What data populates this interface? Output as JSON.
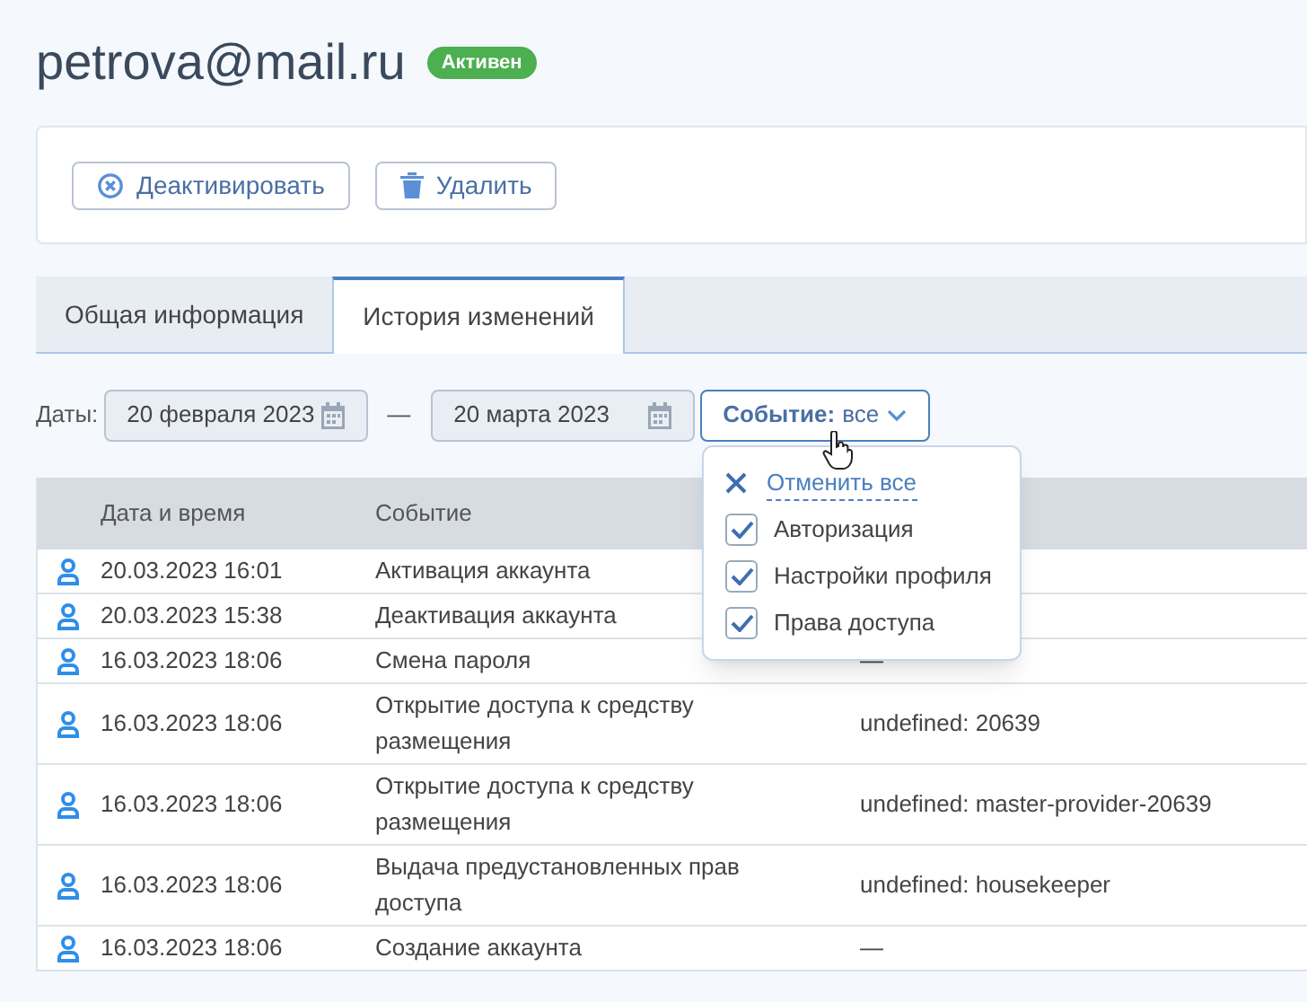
{
  "title": "petrova@mail.ru",
  "status_badge": "Активен",
  "actions": [
    {
      "kind": "deactivate",
      "label": "Деактивировать"
    },
    {
      "kind": "delete",
      "label": "Удалить"
    }
  ],
  "tabs": [
    {
      "label": "Общая информация",
      "selected": false
    },
    {
      "label": "История изменений",
      "selected": true
    }
  ],
  "filters": {
    "dates_label": "Даты:",
    "date_from": "20 февраля 2023",
    "separator": "—",
    "date_to": "20 марта 2023",
    "event_label": "Событие:",
    "event_value": "все"
  },
  "event_menu": {
    "clear": "Отменить все",
    "options": [
      {
        "label": "Авторизация",
        "checked": true
      },
      {
        "label": "Настройки профиля",
        "checked": true
      },
      {
        "label": "Права доступа",
        "checked": true
      }
    ]
  },
  "table": {
    "columns": [
      "Дата и время",
      "Событие"
    ],
    "rows": [
      {
        "date": "20.03.2023 16:01",
        "event": "Активация аккаунта"
      },
      {
        "date": "20.03.2023 15:38",
        "event": "Деактивация аккаунта"
      },
      {
        "date": "16.03.2023 18:06",
        "event": "Смена пароля",
        "details": "—"
      },
      {
        "date": "16.03.2023 18:06",
        "event": "Открытие доступа к средству размещения",
        "details": "undefined: 20639"
      },
      {
        "date": "16.03.2023 18:06",
        "event": "Открытие доступа к средству размещения",
        "details": "undefined: master-provider-20639"
      },
      {
        "date": "16.03.2023 18:06",
        "event": "Выдача предустановленных прав доступа",
        "details": "undefined: housekeeper"
      },
      {
        "date": "16.03.2023 18:06",
        "event": "Создание аккаунта",
        "details": "—"
      }
    ]
  }
}
